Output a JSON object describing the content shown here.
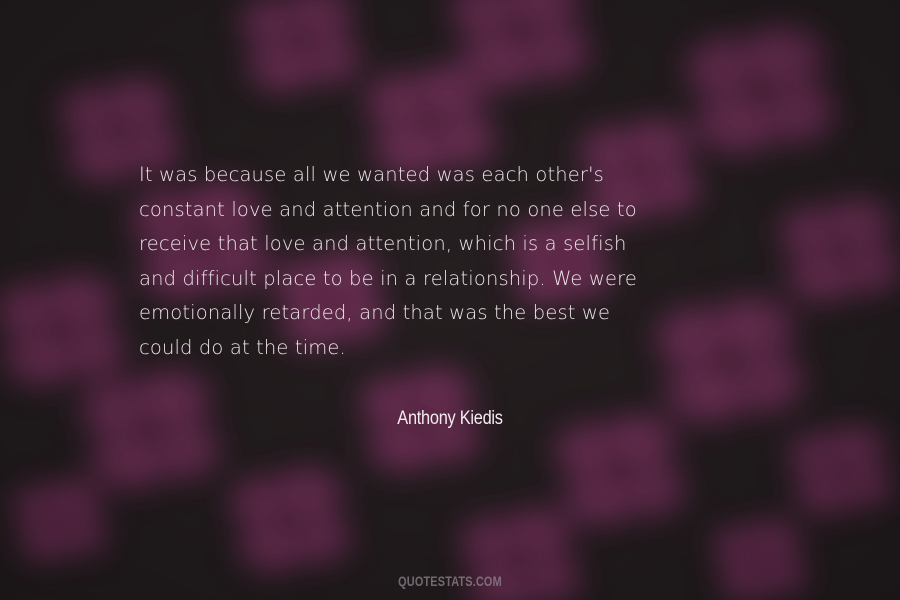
{
  "quote": {
    "lines": [
      "It was because all we wanted was each other's",
      "constant love and attention and for no one else to",
      "receive that love and attention, which is a selfish",
      "and difficult place to be in a relationship. We were",
      "emotionally retarded, and that was the best we",
      "could do at the time."
    ]
  },
  "author": "Anthony Kiedis",
  "watermark": "QUOTESTATS.COM",
  "colors": {
    "petal": "#8e3a68",
    "petal_dark": "#5a2a44",
    "background": "#2a2326",
    "text": "#ece4e8"
  }
}
